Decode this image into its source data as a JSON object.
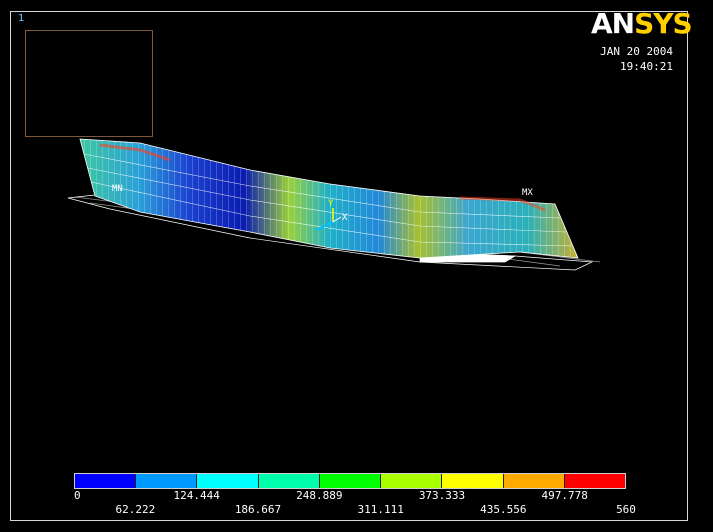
{
  "window": {
    "number": "1"
  },
  "logo": {
    "part1": "AN",
    "part2": "SYS"
  },
  "timestamp": {
    "date": "JAN 20 2004",
    "time": "19:40:21"
  },
  "markers": {
    "min": "MN",
    "max": "MX",
    "axis_y": "Y",
    "axis_x": "X"
  },
  "legend": {
    "labels_top": [
      "0",
      "124.444",
      "248.889",
      "373.333",
      "497.778"
    ],
    "labels_bottom": [
      "62.222",
      "186.667",
      "311.111",
      "435.556",
      "560"
    ],
    "colors": [
      "#0000ff",
      "#0099ff",
      "#00ffff",
      "#00ffaa",
      "#00ff00",
      "#aaff00",
      "#ffff00",
      "#ffaa00",
      "#ff0000"
    ]
  }
}
